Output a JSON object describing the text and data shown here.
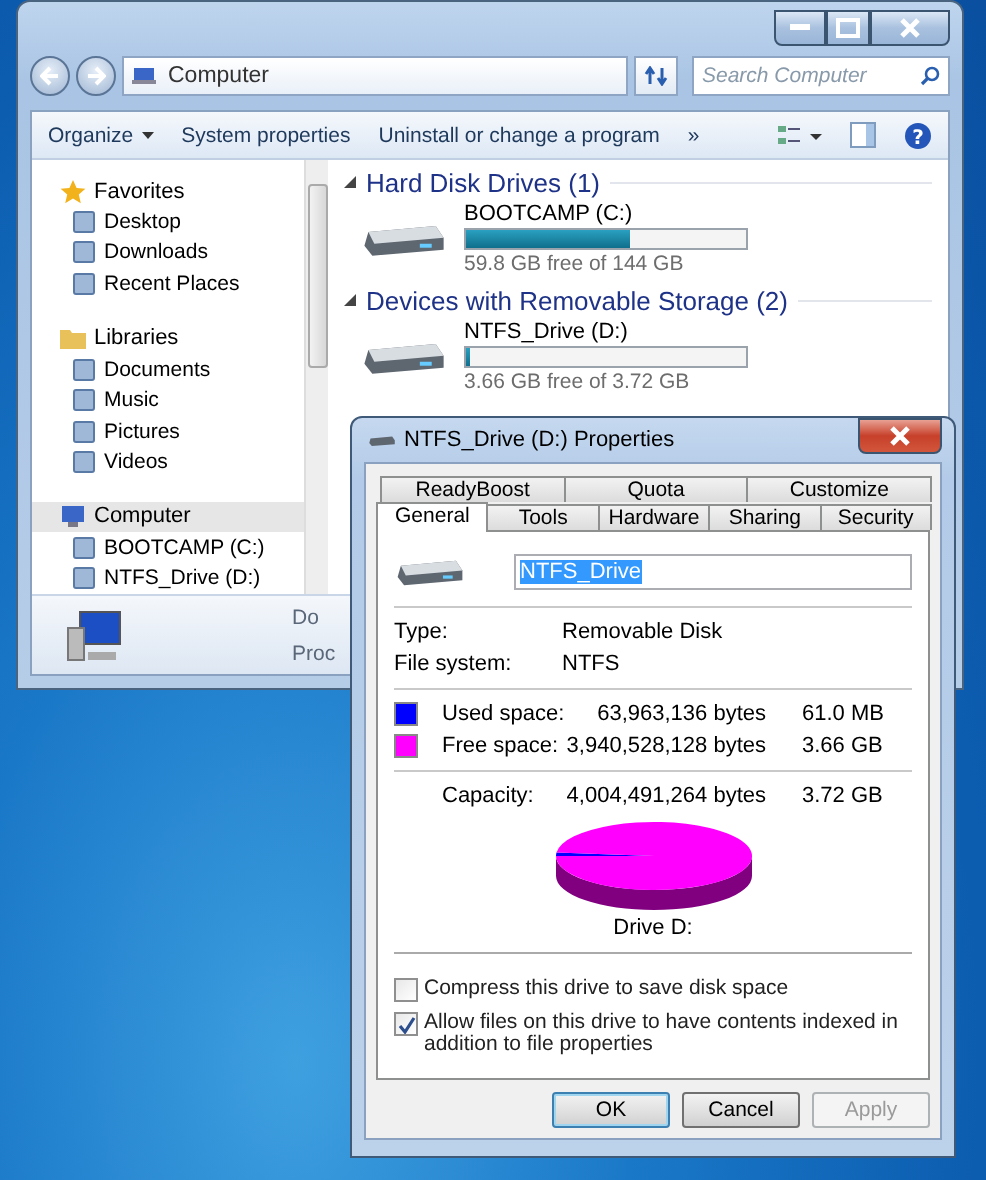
{
  "explorer": {
    "address": {
      "path": "Computer",
      "search_placeholder": "Search Computer"
    },
    "toolbar": [
      {
        "label": "Organize",
        "dropdown": true
      },
      {
        "label": "System properties",
        "dropdown": false
      },
      {
        "label": "Uninstall or change a program",
        "dropdown": false
      }
    ],
    "toolbar_more": "»",
    "help": "?",
    "nav": [
      {
        "label": "Favorites",
        "selected": false,
        "children": [
          {
            "label": "Desktop",
            "selected": false
          },
          {
            "label": "Downloads",
            "selected": false
          },
          {
            "label": "Recent Places",
            "selected": false
          }
        ]
      },
      {
        "label": "Libraries",
        "selected": false,
        "children": [
          {
            "label": "Documents",
            "selected": false
          },
          {
            "label": "Music",
            "selected": false
          },
          {
            "label": "Pictures",
            "selected": false
          },
          {
            "label": "Videos",
            "selected": false
          }
        ]
      },
      {
        "label": "Computer",
        "selected": true,
        "children": [
          {
            "label": "BOOTCAMP (C:)",
            "selected": false
          },
          {
            "label": "NTFS_Drive (D:)",
            "selected": false
          }
        ]
      }
    ],
    "sections": [
      {
        "title": "Hard Disk Drives (1)",
        "expanded": true,
        "drives": [
          {
            "name": "BOOTCAMP (C:)",
            "level": 0.585,
            "free": "59.8 GB free of 144 GB"
          }
        ]
      },
      {
        "title": "Devices with Removable Storage (2)",
        "expanded": true,
        "drives": [
          {
            "name": "NTFS_Drive (D:)",
            "level": 0.016,
            "free": "3.66 GB free of 3.72 GB"
          }
        ]
      }
    ],
    "details": [
      "Do",
      "Proc"
    ]
  },
  "dialog": {
    "title": "NTFS_Drive (D:) Properties",
    "tab_rows": [
      [
        {
          "label": "ReadyBoost",
          "selected": false
        },
        {
          "label": "Quota",
          "selected": false
        },
        {
          "label": "Customize",
          "selected": false
        }
      ],
      [
        {
          "label": "General",
          "selected": true
        },
        {
          "label": "Tools",
          "selected": false
        },
        {
          "label": "Hardware",
          "selected": false
        },
        {
          "label": "Sharing",
          "selected": false
        },
        {
          "label": "Security",
          "selected": false
        }
      ]
    ],
    "name_value": "NTFS_Drive",
    "info": [
      {
        "label": "Type:",
        "value": "Removable Disk"
      },
      {
        "label": "File system:",
        "value": "NTFS"
      }
    ],
    "space": [
      {
        "label": "Used space:",
        "bytes": "63,963,136 bytes",
        "size": "61.0 MB",
        "color": "#0000ff"
      },
      {
        "label": "Free space:",
        "bytes": "3,940,528,128 bytes",
        "size": "3.66 GB",
        "color": "#ff00ff"
      }
    ],
    "capacity": {
      "label": "Capacity:",
      "bytes": "4,004,491,264 bytes",
      "size": "3.72 GB"
    },
    "pie": {
      "caption": "Drive D:"
    },
    "options": [
      {
        "label": "Compress this drive to save disk space",
        "checked": false
      },
      {
        "label": "Allow files on this drive to have contents indexed in addition to file properties",
        "checked": true
      }
    ],
    "buttons": [
      {
        "label": "OK",
        "default": true,
        "disabled": false
      },
      {
        "label": "Cancel",
        "default": false,
        "disabled": false
      },
      {
        "label": "Apply",
        "default": false,
        "disabled": true
      }
    ]
  }
}
